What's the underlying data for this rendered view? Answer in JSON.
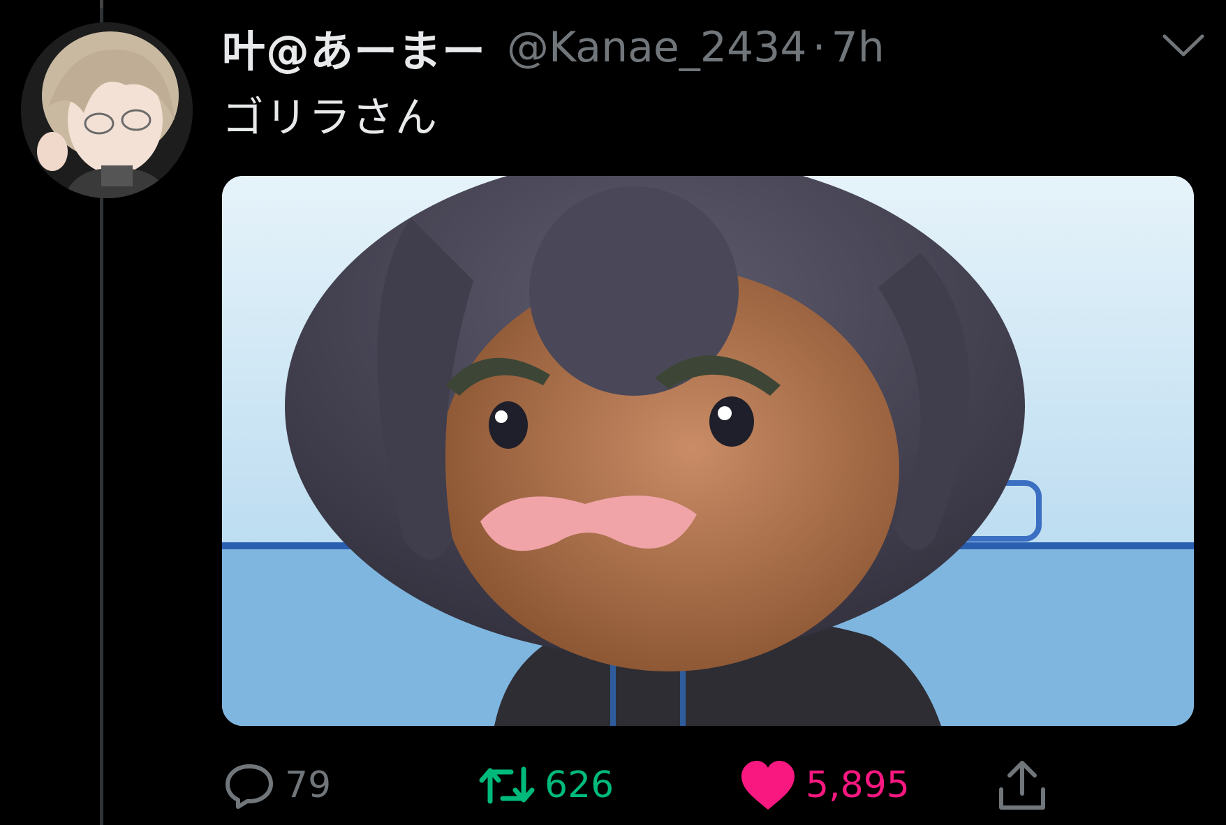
{
  "tweet": {
    "display_name": "叶@あーまー",
    "handle": "@Kanae_2434",
    "separator": "·",
    "time": "7h",
    "text": "ゴリラさん"
  },
  "actions": {
    "reply_count": "79",
    "retweet_count": "626",
    "like_count": "5,895"
  },
  "colors": {
    "background": "#000000",
    "retweet_active": "#00ba7c",
    "like_active": "#f91880",
    "muted": "#71767b"
  },
  "icons": [
    "avatar",
    "chevron-down-icon",
    "reply-icon",
    "retweet-icon",
    "heart-icon",
    "share-icon"
  ]
}
